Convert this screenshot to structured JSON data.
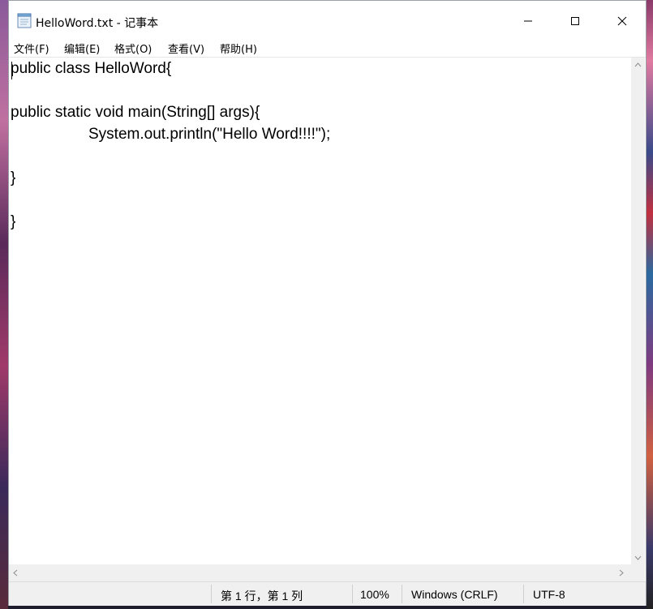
{
  "window": {
    "title": "HelloWord.txt - 记事本",
    "controls": {
      "minimize": "minimize",
      "maximize": "maximize",
      "close": "close"
    }
  },
  "menu": [
    {
      "label": "文件(F)"
    },
    {
      "label": "编辑(E)"
    },
    {
      "label": "格式(O)"
    },
    {
      "label": "查看(V)"
    },
    {
      "label": "帮助(H)"
    }
  ],
  "editor": {
    "lines": [
      "public class HelloWord{",
      "",
      "public static void main(String[] args){",
      "\t\tSystem.out.println(\"Hello Word!!!!\");",
      "",
      "}",
      "",
      "",
      "}"
    ]
  },
  "status": {
    "position": "第 1 行，第 1 列",
    "zoom": "100%",
    "line_ending": "Windows (CRLF)",
    "encoding": "UTF-8"
  },
  "icons": {
    "app": "notepad-icon",
    "minimize": "minimize-icon",
    "maximize": "maximize-icon",
    "close": "close-icon"
  }
}
